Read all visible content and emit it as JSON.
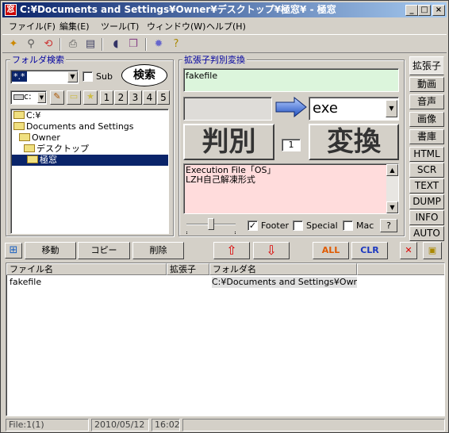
{
  "title": "C:¥Documents and Settings¥Owner¥デスクトップ¥極窓¥ - 極窓",
  "app_icon": "窓",
  "window_controls": {
    "minimize": "_",
    "maximize": "□",
    "close": "×"
  },
  "menu": [
    "ファイル(F)",
    "編集(E)",
    "ツール(T)",
    "ウィンドウ(W)",
    "ヘルプ(H)"
  ],
  "folder_search": {
    "label": "フォルダ検索",
    "pattern": "*.*",
    "sub_label": "Sub",
    "search_button": "検索",
    "drive": "c:",
    "num_buttons": [
      "1",
      "2",
      "3",
      "4",
      "5"
    ]
  },
  "tree": [
    "C:¥",
    "Documents and Settings",
    "Owner",
    "デスクトップ",
    "極窓"
  ],
  "ext": {
    "label": "拡張子判別変換",
    "filename": "fakefile",
    "result": "exe",
    "judge_button": "判別",
    "convert_button": "変換",
    "count": "1",
    "description_line1": "Execution File「OS」",
    "description_line2": "LZH自己解凍形式",
    "footer_label": "Footer",
    "special_label": "Special",
    "mac_label": "Mac",
    "help_button": "?"
  },
  "side_tabs": [
    "拡張子",
    "動画",
    "音声",
    "画像",
    "書庫",
    "HTML",
    "SCR",
    "TEXT",
    "DUMP",
    "INFO",
    "AUTO"
  ],
  "actions": {
    "move": "移動",
    "copy": "コピー",
    "delete": "削除",
    "all": "ALL",
    "clr": "CLR"
  },
  "table": {
    "columns": [
      "ファイル名",
      "拡張子",
      "フォルダ名"
    ],
    "rows": [
      {
        "name": "fakefile",
        "ext": "",
        "folder": "C:¥Documents and Settings¥Own..."
      }
    ]
  },
  "status": {
    "file": "File:1(1)",
    "date": "2010/05/12",
    "time": "16:02"
  }
}
